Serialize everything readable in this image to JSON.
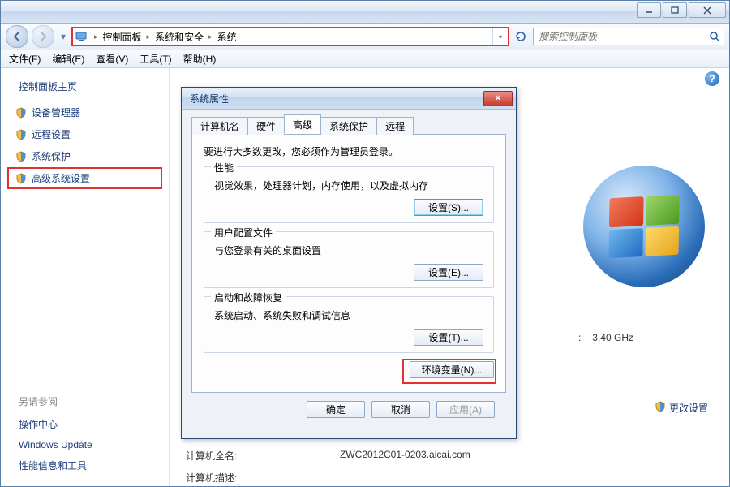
{
  "breadcrumb": {
    "items": [
      "控制面板",
      "系统和安全",
      "系统"
    ]
  },
  "search": {
    "placeholder": "搜索控制面板"
  },
  "menu": {
    "file": "文件(F)",
    "edit": "编辑(E)",
    "view": "查看(V)",
    "tools": "工具(T)",
    "help": "帮助(H)"
  },
  "sidebar": {
    "home": "控制面板主页",
    "items": [
      {
        "label": "设备管理器"
      },
      {
        "label": "远程设置"
      },
      {
        "label": "系统保护"
      },
      {
        "label": "高级系统设置"
      }
    ],
    "also_title": "另请参阅",
    "also": [
      {
        "label": "操作中心"
      },
      {
        "label": "Windows Update"
      },
      {
        "label": "性能信息和工具"
      }
    ]
  },
  "main": {
    "cpu_suffix": "3.40 GHz",
    "change_settings": "更改设置",
    "full_name_label": "计算机全名:",
    "full_name_value": "ZWC2012C01-0203.aicai.com",
    "desc_label": "计算机描述:"
  },
  "dialog": {
    "title": "系统属性",
    "tabs": {
      "computer": "计算机名",
      "hardware": "硬件",
      "advanced": "高级",
      "protection": "系统保护",
      "remote": "远程"
    },
    "note": "要进行大多数更改，您必须作为管理员登录。",
    "perf": {
      "title": "性能",
      "text": "视觉效果，处理器计划，内存使用，以及虚拟内存",
      "btn": "设置(S)..."
    },
    "profile": {
      "title": "用户配置文件",
      "text": "与您登录有关的桌面设置",
      "btn": "设置(E)..."
    },
    "startup": {
      "title": "启动和故障恢复",
      "text": "系统启动、系统失败和调试信息",
      "btn": "设置(T)..."
    },
    "env_btn": "环境变量(N)...",
    "ok": "确定",
    "cancel": "取消",
    "apply": "应用(A)"
  }
}
